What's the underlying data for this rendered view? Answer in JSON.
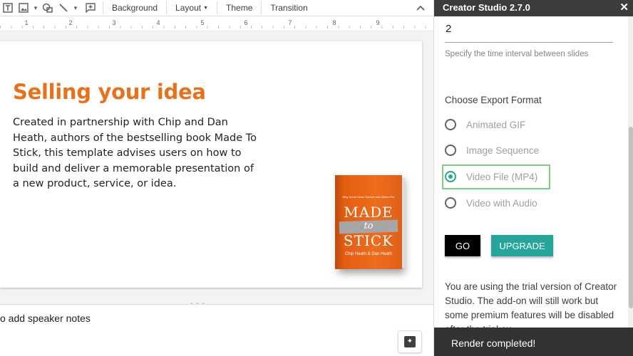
{
  "toolbar": {
    "icons": [
      "text-box-icon",
      "image-icon",
      "shape-icon",
      "line-icon",
      "comment-icon"
    ],
    "background_label": "Background",
    "layout_label": "Layout",
    "theme_label": "Theme",
    "transition_label": "Transition"
  },
  "ruler": {
    "numbers": [
      "1",
      "2",
      "3",
      "4",
      "5",
      "6",
      "7",
      "8",
      "9"
    ]
  },
  "slide": {
    "title": "Selling your idea",
    "body": "Created in partnership with Chip and Dan Heath, authors of the bestselling book Made To Stick, this template advises users on how to build and deliver a memorable presentation of a new product, service, or idea.",
    "book": {
      "small_text": "Why Some Ideas Survive and Others Die",
      "title_line1": "MADE",
      "title_line2": "to",
      "title_line3": "STICK",
      "authors": "Chip Heath & Dan Heath"
    }
  },
  "notes": {
    "placeholder": "o add speaker notes"
  },
  "panel": {
    "title": "Creator Studio 2.7.0",
    "interval_value": "2",
    "interval_help": "Specify the time interval between slides",
    "export_label": "Choose Export Format",
    "formats": [
      {
        "label": "Animated GIF",
        "selected": false
      },
      {
        "label": "Image Sequence",
        "selected": false
      },
      {
        "label": "Video File (MP4)",
        "selected": true
      },
      {
        "label": "Video with Audio",
        "selected": false
      }
    ],
    "go_label": "GO",
    "upgrade_label": "UPGRADE",
    "trial_text": "You are using the trial version of Creator Studio. The add-on will still work but some premium features will be disabled after the trial ex",
    "accent_color": "#26a69a"
  },
  "toast": {
    "message": "Render completed!"
  }
}
